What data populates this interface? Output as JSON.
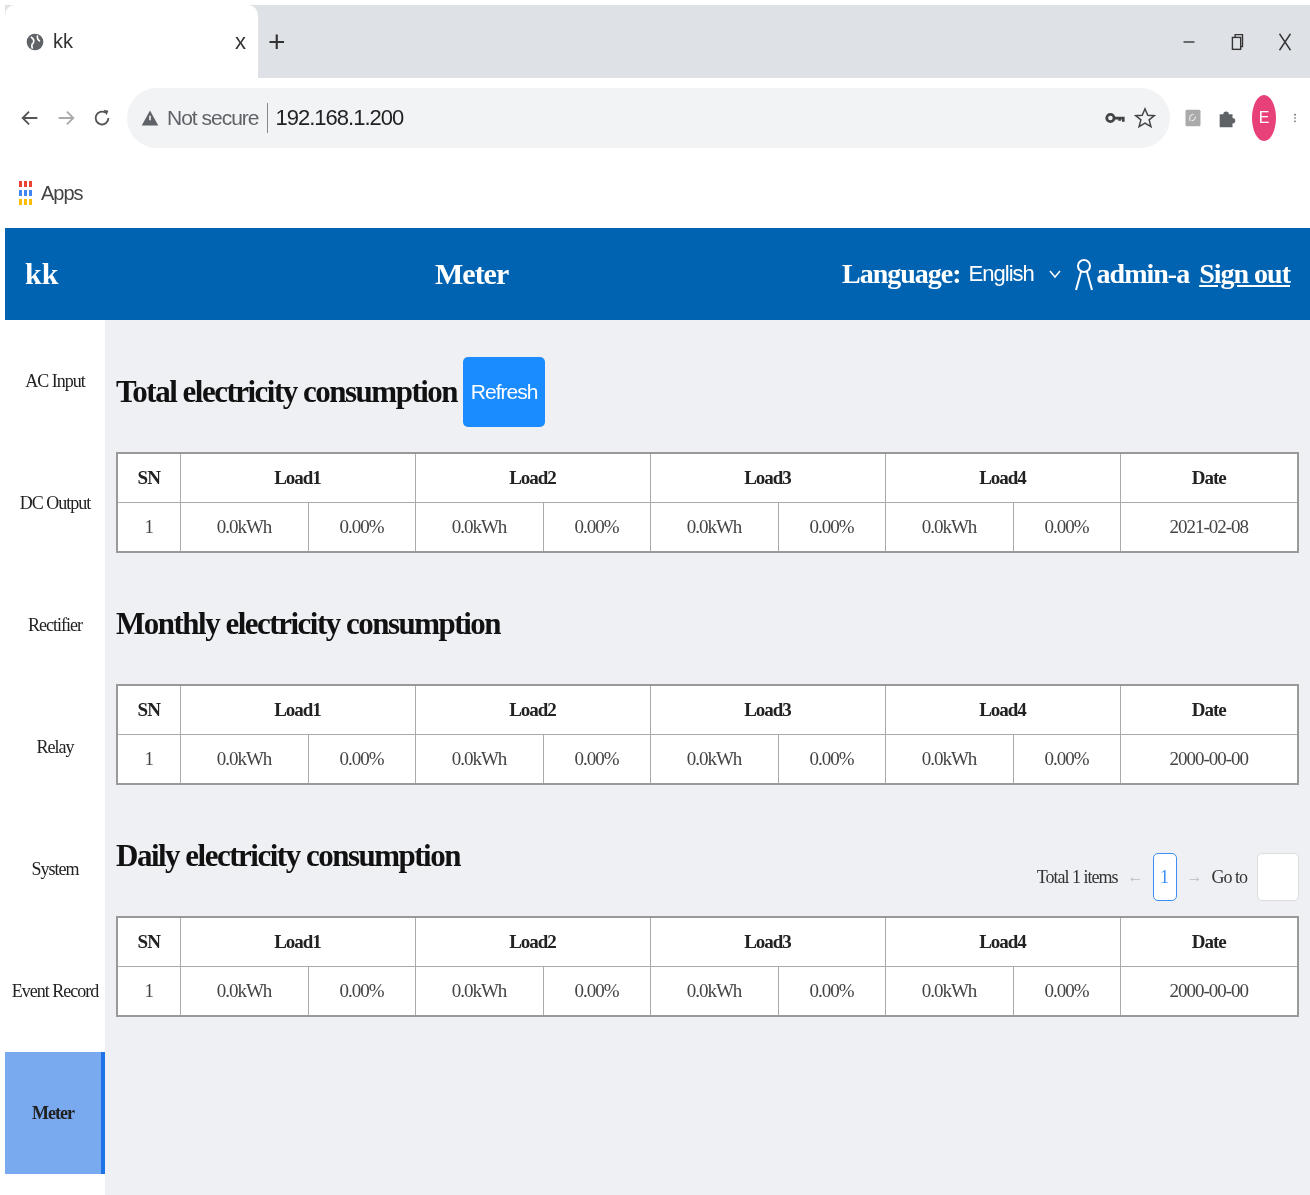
{
  "browser": {
    "tab": {
      "title": "kk",
      "close": "x"
    },
    "new_tab": "+",
    "address": {
      "security": "Not secure",
      "url": "192.168.1.200"
    },
    "profile": "E",
    "bookmarks": [
      {
        "label": "Apps"
      }
    ]
  },
  "header": {
    "brand": "kk",
    "title": "Meter",
    "language_label": "Language:",
    "language": "English",
    "user": "admin-a",
    "sign_out": "Sign out"
  },
  "sidebar": {
    "items": [
      {
        "label": "AC Input",
        "selected": false
      },
      {
        "label": "DC Output",
        "selected": false
      },
      {
        "label": "Rectifier",
        "selected": false
      },
      {
        "label": "Relay",
        "selected": false
      },
      {
        "label": "System",
        "selected": false
      },
      {
        "label": "Event Record",
        "selected": false
      },
      {
        "label": "Meter",
        "selected": true
      }
    ]
  },
  "sections": [
    {
      "title": "Total electricity consumption",
      "button": "Refresh",
      "table": {
        "columns": [
          {
            "label": "SN"
          },
          {
            "label": "Load1",
            "colspan": 2
          },
          {
            "label": "Load2",
            "colspan": 2
          },
          {
            "label": "Load3",
            "colspan": 2
          },
          {
            "label": "Load4",
            "colspan": 2
          },
          {
            "label": "Date"
          }
        ],
        "rows": [
          [
            "1",
            "0.0kWh",
            "0.00%",
            "0.0kWh",
            "0.00%",
            "0.0kWh",
            "0.00%",
            "0.0kWh",
            "0.00%",
            "2021-02-08"
          ]
        ]
      }
    },
    {
      "title": "Monthly electricity consumption",
      "table": {
        "columns": [
          {
            "label": "SN"
          },
          {
            "label": "Load1",
            "colspan": 2
          },
          {
            "label": "Load2",
            "colspan": 2
          },
          {
            "label": "Load3",
            "colspan": 2
          },
          {
            "label": "Load4",
            "colspan": 2
          },
          {
            "label": "Date"
          }
        ],
        "rows": [
          [
            "1",
            "0.0kWh",
            "0.00%",
            "0.0kWh",
            "0.00%",
            "0.0kWh",
            "0.00%",
            "0.0kWh",
            "0.00%",
            "2000-00-00"
          ]
        ]
      }
    },
    {
      "title": "Daily electricity consumption",
      "pagination": {
        "total": "Total 1 items",
        "prev": "←",
        "pages": [
          {
            "label": "1",
            "selected": true
          }
        ],
        "next": "→",
        "goto": "Go to"
      },
      "table": {
        "columns": [
          {
            "label": "SN"
          },
          {
            "label": "Load1",
            "colspan": 2
          },
          {
            "label": "Load2",
            "colspan": 2
          },
          {
            "label": "Load3",
            "colspan": 2
          },
          {
            "label": "Load4",
            "colspan": 2
          },
          {
            "label": "Date"
          }
        ],
        "rows": [
          [
            "1",
            "0.0kWh",
            "0.00%",
            "0.0kWh",
            "0.00%",
            "0.0kWh",
            "0.00%",
            "0.0kWh",
            "0.00%",
            "2000-00-00"
          ]
        ]
      }
    }
  ]
}
